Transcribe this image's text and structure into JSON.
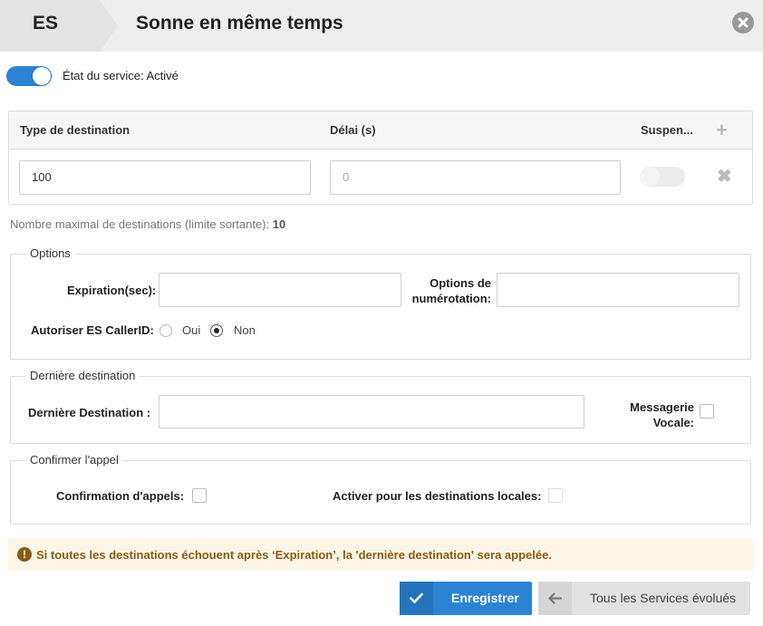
{
  "header": {
    "code": "ES",
    "title": "Sonne en même temps"
  },
  "service": {
    "status_label": "État du service: Activé",
    "enabled": true
  },
  "destinations": {
    "columns": [
      "Type de destination",
      "Délai (s)",
      "Suspen..."
    ],
    "rows": [
      {
        "type_value": "100",
        "delay_placeholder": "0",
        "suspended": false
      }
    ],
    "max_label": "Nombre maximal de destinations (limite sortante):",
    "max_value": "10"
  },
  "options": {
    "legend": "Options",
    "expiration_label": "Expiration(sec):",
    "expiration_value": "",
    "dial_options_label": "Options de numérotation:",
    "dial_options_value": "",
    "callerid_label": "Autoriser ES CallerID:",
    "callerid_yes": "Oui",
    "callerid_no": "Non",
    "callerid_selected": "Non"
  },
  "last_destination": {
    "legend": "Dernière destination",
    "label": "Dernière Destination :",
    "value": "",
    "voicemail_label": "Messagerie Vocale:",
    "voicemail_checked": false
  },
  "confirm": {
    "legend": "Confirmer l'appel",
    "call_confirmation_label": "Confirmation d'appels:",
    "call_confirmation_checked": false,
    "local_destinations_label": "Activer pour les destinations locales:",
    "local_destinations_checked": false
  },
  "warning": {
    "icon": "exclamation-circle-icon",
    "text": "Si toutes les destinations échouent après ‘Expiration’, la 'dernière destination' sera appelée."
  },
  "buttons": {
    "save_label": "Enregistrer",
    "back_label": "Tous les Services évolués"
  },
  "colors": {
    "accent": "#2b84d3",
    "warning_text": "#8a5a12",
    "warning_bg": "#fcf6e8"
  }
}
